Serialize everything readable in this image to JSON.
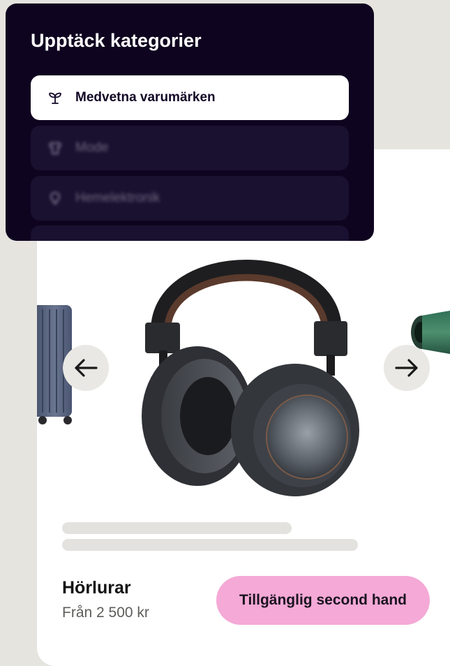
{
  "categories_panel": {
    "title": "Upptäck kategorier",
    "items": [
      {
        "label": "Medvetna varumärken",
        "icon": "sprout-icon",
        "active": true
      },
      {
        "label": "Mode",
        "icon": "tshirt-icon",
        "active": false
      },
      {
        "label": "Hemelektronik",
        "icon": "lightbulb-icon",
        "active": false
      },
      {
        "label": "",
        "icon": "hidden-category-icon",
        "active": false
      }
    ]
  },
  "product_card": {
    "name": "Hörlurar",
    "price": "Från 2 500 kr",
    "cta_label": "Tillgänglig second hand",
    "carousel": {
      "prev_icon": "arrow-left-icon",
      "next_icon": "arrow-right-icon",
      "images": [
        "suitcase",
        "headphones",
        "hair-dryer"
      ]
    }
  },
  "colors": {
    "panel_bg": "#0f041f",
    "cta_bg": "#f4a9d6",
    "page_bg": "#e6e4df"
  }
}
